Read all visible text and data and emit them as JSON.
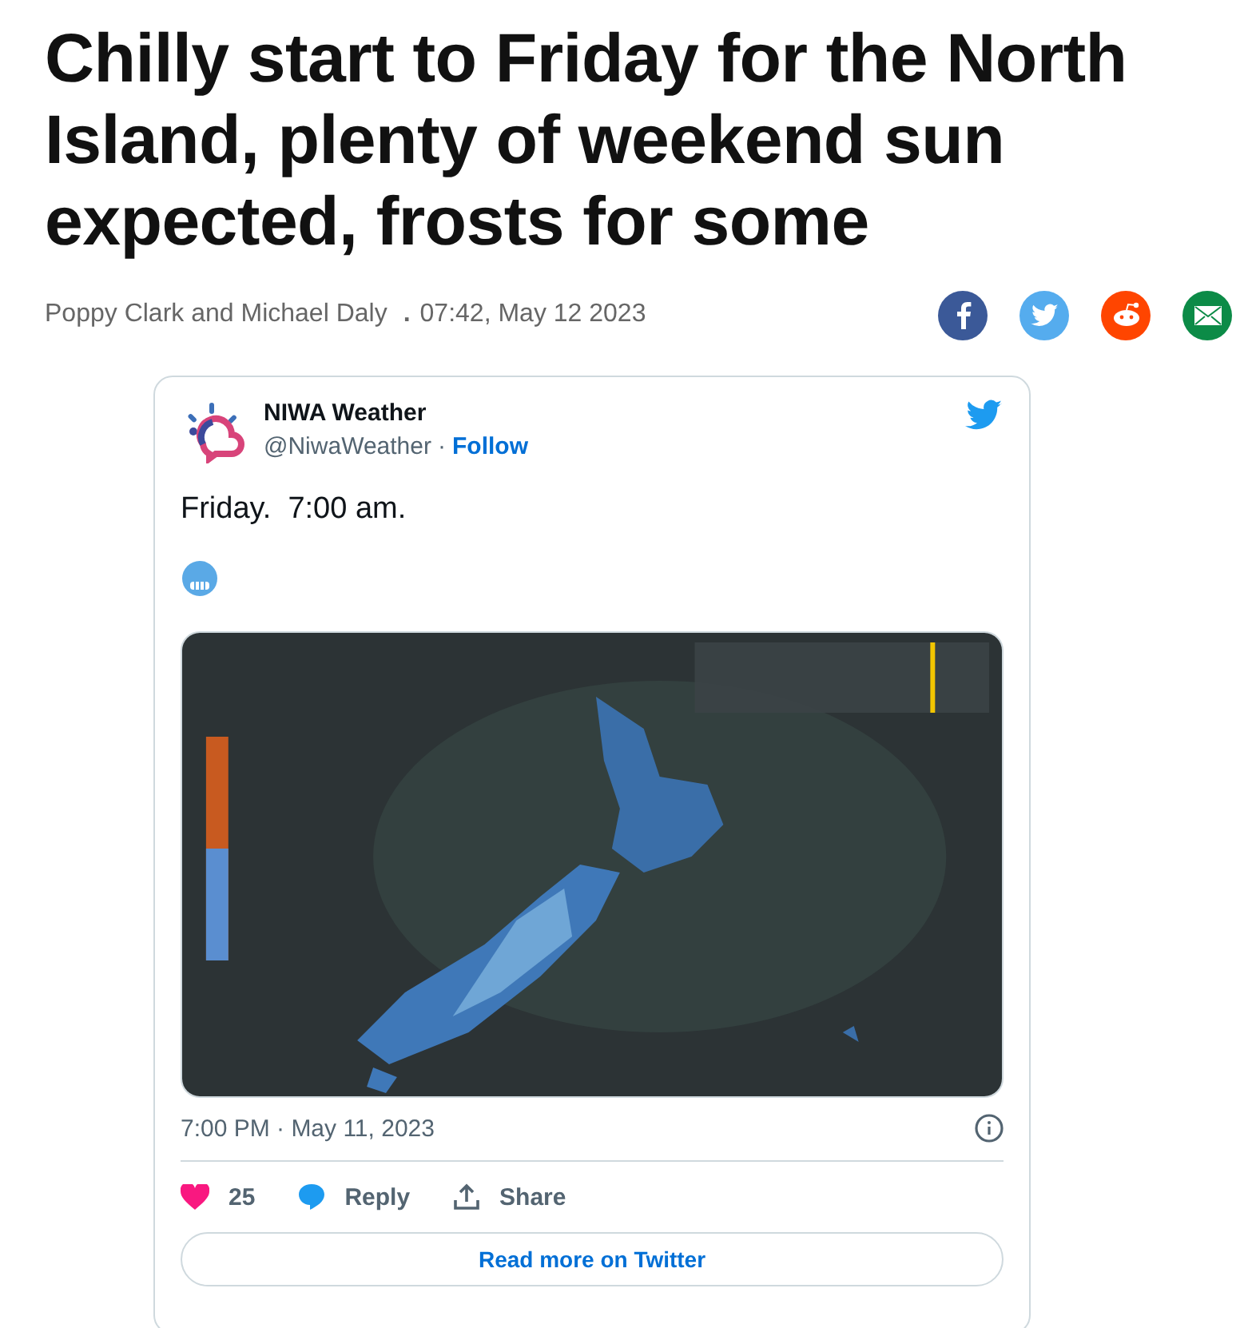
{
  "headline": "Chilly start to Friday for the North Island, plenty of weekend sun expected, frosts for some",
  "byline": {
    "authors": "Poppy Clark and Michael Daly",
    "separator": ".",
    "timestamp": "07:42, May 12 2023"
  },
  "share_buttons": [
    {
      "kind": "facebook"
    },
    {
      "kind": "twitter"
    },
    {
      "kind": "reddit"
    },
    {
      "kind": "email"
    }
  ],
  "tweet": {
    "name": "NIWA Weather",
    "handle": "@NiwaWeather",
    "dot": "·",
    "follow": "Follow",
    "text": "Friday.  7:00 am.",
    "timestamp": "7:00 PM · May 11, 2023",
    "likes": "25",
    "reply": "Reply",
    "share": "Share",
    "read_more": "Read more on Twitter"
  }
}
